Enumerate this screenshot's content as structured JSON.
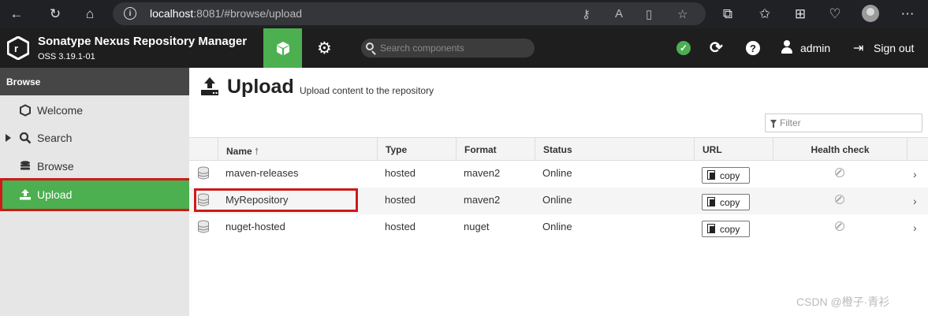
{
  "browser": {
    "url_host": "localhost",
    "url_rest": ":8081/#browse/upload"
  },
  "header": {
    "brand_title": "Sonatype Nexus Repository Manager",
    "brand_version": "OSS 3.19.1-01",
    "search_placeholder": "Search components",
    "user_name": "admin",
    "sign_out_label": "Sign out"
  },
  "sidebar": {
    "section_title": "Browse",
    "items": [
      {
        "label": "Welcome",
        "icon": "hexagon-icon"
      },
      {
        "label": "Search",
        "icon": "search-icon"
      },
      {
        "label": "Browse",
        "icon": "database-icon"
      },
      {
        "label": "Upload",
        "icon": "upload-icon",
        "active": true
      }
    ]
  },
  "page": {
    "title": "Upload",
    "subtitle": "Upload content to the repository",
    "filter_placeholder": "Filter"
  },
  "table": {
    "columns": [
      "Name",
      "Type",
      "Format",
      "Status",
      "URL",
      "Health check"
    ],
    "sort_indicator": "🠕",
    "copy_label": "copy",
    "rows": [
      {
        "name": "maven-releases",
        "type": "hosted",
        "format": "maven2",
        "status": "Online"
      },
      {
        "name": "MyRepository",
        "type": "hosted",
        "format": "maven2",
        "status": "Online"
      },
      {
        "name": "nuget-hosted",
        "type": "hosted",
        "format": "nuget",
        "status": "Online"
      }
    ]
  },
  "watermark": "CSDN @橙子·青衫",
  "colors": {
    "accent_green": "#4caf50",
    "header_dark": "#1e1e1e",
    "highlight_red": "#d0191a"
  }
}
